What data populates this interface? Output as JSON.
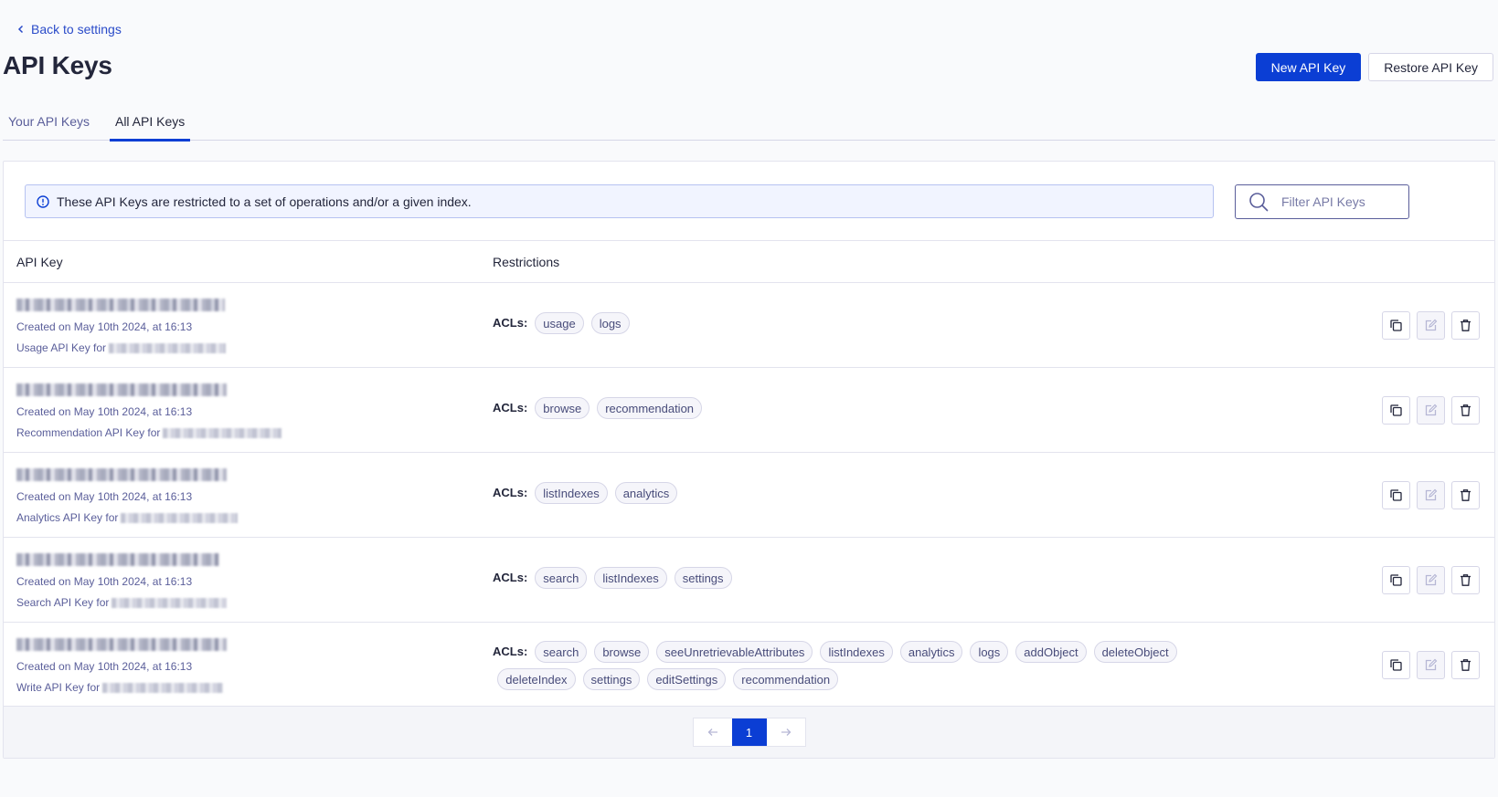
{
  "nav": {
    "back_label": "Back to settings"
  },
  "header": {
    "title": "API Keys",
    "new_key_label": "New API Key",
    "restore_key_label": "Restore API Key"
  },
  "tabs": [
    {
      "label": "Your API Keys",
      "active": false
    },
    {
      "label": "All API Keys",
      "active": true
    }
  ],
  "banner": {
    "text": "These API Keys are restricted to a set of operations and/or a given index."
  },
  "filter": {
    "placeholder": "Filter API Keys"
  },
  "table": {
    "columns": [
      "API Key",
      "Restrictions"
    ],
    "acl_label": "ACLs:",
    "rows": [
      {
        "created": "Created on May 10th 2024, at 16:13",
        "description": "Usage API Key for",
        "acls": [
          "usage",
          "logs"
        ]
      },
      {
        "created": "Created on May 10th 2024, at 16:13",
        "description": "Recommendation API Key for",
        "acls": [
          "browse",
          "recommendation"
        ]
      },
      {
        "created": "Created on May 10th 2024, at 16:13",
        "description": "Analytics API Key for",
        "acls": [
          "listIndexes",
          "analytics"
        ]
      },
      {
        "created": "Created on May 10th 2024, at 16:13",
        "description": "Search API Key for",
        "acls": [
          "search",
          "listIndexes",
          "settings"
        ]
      },
      {
        "created": "Created on May 10th 2024, at 16:13",
        "description": "Write API Key for",
        "acls": [
          "search",
          "browse",
          "seeUnretrievableAttributes",
          "listIndexes",
          "analytics",
          "logs",
          "addObject",
          "deleteObject",
          "deleteIndex",
          "settings",
          "editSettings",
          "recommendation"
        ]
      }
    ]
  },
  "pagination": {
    "current_page": "1"
  },
  "colors": {
    "accent": "#0b3ed4",
    "text": "#23263b",
    "muted": "#5a5e9a"
  }
}
